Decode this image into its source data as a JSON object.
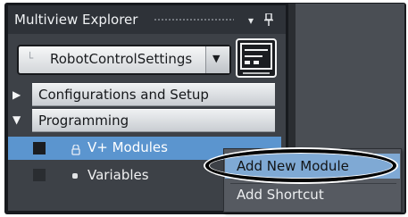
{
  "panel": {
    "title": "Multiview Explorer",
    "pin_glyph": "▾",
    "close_glyph": "❘"
  },
  "device_selector": {
    "value": "RobotControlSettings",
    "arrow_glyph": "▼",
    "prefix_glyph": "└"
  },
  "tree": {
    "configurations": {
      "label": "Configurations and Setup",
      "expander": "▶"
    },
    "programming": {
      "label": "Programming",
      "expander": "▼"
    },
    "v_modules": {
      "label": "V+ Modules"
    },
    "variables": {
      "label": "Variables"
    }
  },
  "context_menu": {
    "items": [
      "Add New Module",
      "Add Shortcut"
    ]
  },
  "colors": {
    "selection": "#5b95cf",
    "menu_highlight": "#7fa9d4",
    "panel_bg": "#3d4147"
  },
  "icons": {
    "controller": "controller-icon",
    "module": "module-icon",
    "variables": "variables-icon"
  }
}
